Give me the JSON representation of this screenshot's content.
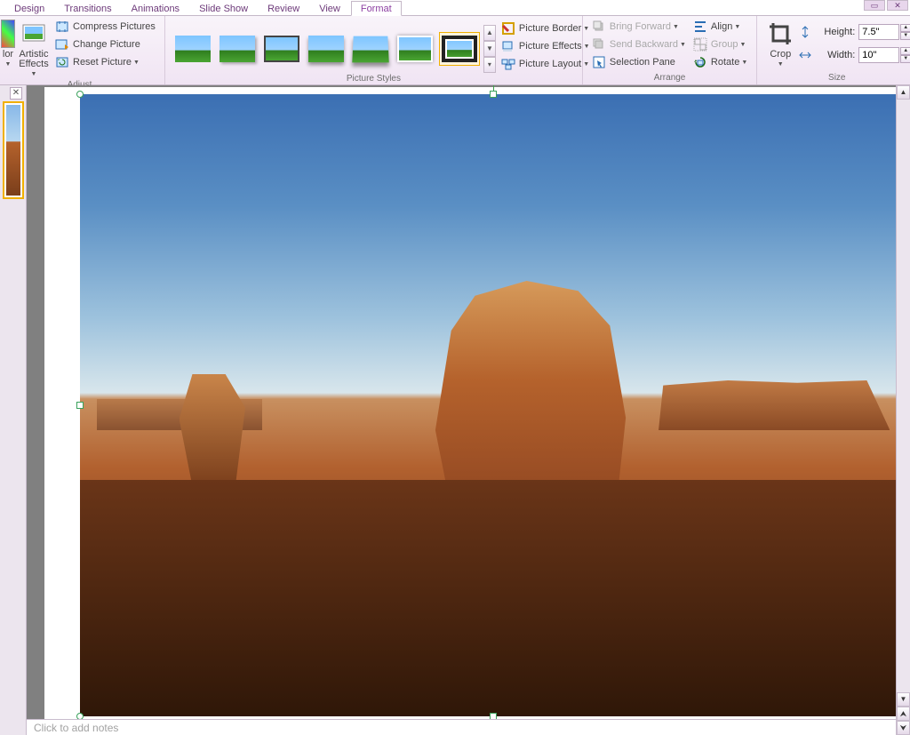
{
  "tabs": {
    "design": "Design",
    "transitions": "Transitions",
    "animations": "Animations",
    "slideshow": "Slide Show",
    "review": "Review",
    "view": "View",
    "format": "Format"
  },
  "groups": {
    "adjust": "Adjust",
    "picture_styles": "Picture Styles",
    "arrange": "Arrange",
    "size": "Size"
  },
  "adjust": {
    "color": "lor",
    "artistic": "Artistic Effects",
    "compress": "Compress Pictures",
    "change": "Change Picture",
    "reset": "Reset Picture"
  },
  "pstyles": {
    "border": "Picture Border",
    "effects": "Picture Effects",
    "layout": "Picture Layout"
  },
  "arrange": {
    "bring_forward": "Bring Forward",
    "send_backward": "Send Backward",
    "selection_pane": "Selection Pane",
    "align": "Align",
    "group": "Group",
    "rotate": "Rotate"
  },
  "size": {
    "crop": "Crop",
    "height_label": "Height:",
    "width_label": "Width:",
    "height_value": "7.5\"",
    "width_value": "10\""
  },
  "notes_placeholder": "Click to add notes"
}
